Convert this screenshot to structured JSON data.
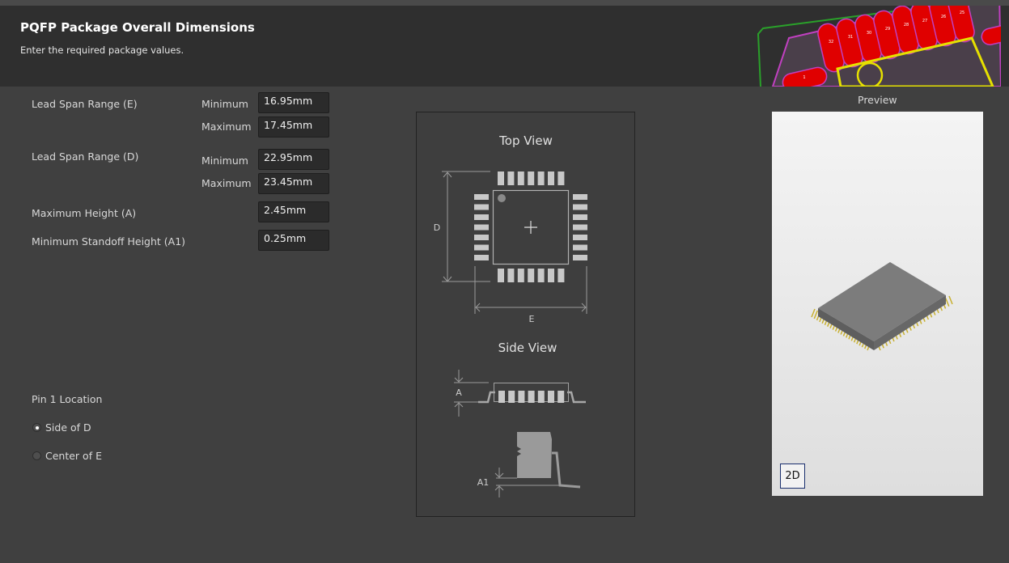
{
  "header": {
    "title": "PQFP Package Overall Dimensions",
    "subtitle": "Enter the required package values."
  },
  "fields": [
    {
      "label": "Lead Span Range (E)",
      "sub": "Minimum",
      "value": "16.95mm"
    },
    {
      "sub": "Maximum",
      "value": "17.45mm"
    },
    {
      "label": "Lead Span Range (D)",
      "sub": "Minimum",
      "value": "22.95mm"
    },
    {
      "sub": "Maximum",
      "value": "23.45mm"
    },
    {
      "label": "Maximum Height (A)",
      "value": "2.45mm"
    },
    {
      "label": "Minimum Standoff Height (A1)",
      "value": "0.25mm"
    }
  ],
  "pin1": {
    "label": "Pin 1 Location",
    "options": [
      {
        "label": "Side of D",
        "selected": true
      },
      {
        "label": "Center of E",
        "selected": false
      }
    ]
  },
  "diagram": {
    "top_view": "Top View",
    "side_view": "Side View",
    "d": "D",
    "e": "E",
    "a": "A",
    "a1": "A1"
  },
  "preview": {
    "label": "Preview",
    "mode_button": "2D"
  },
  "pcb_pad_numbers": [
    "32",
    "31",
    "30",
    "29",
    "28",
    "27",
    "26",
    "25",
    "1"
  ],
  "colors": {
    "pad": "#e00000",
    "silk": "#e6e000",
    "outline": "#2aa02a",
    "body": "#7a7a7a",
    "lead": "#c8b030"
  }
}
